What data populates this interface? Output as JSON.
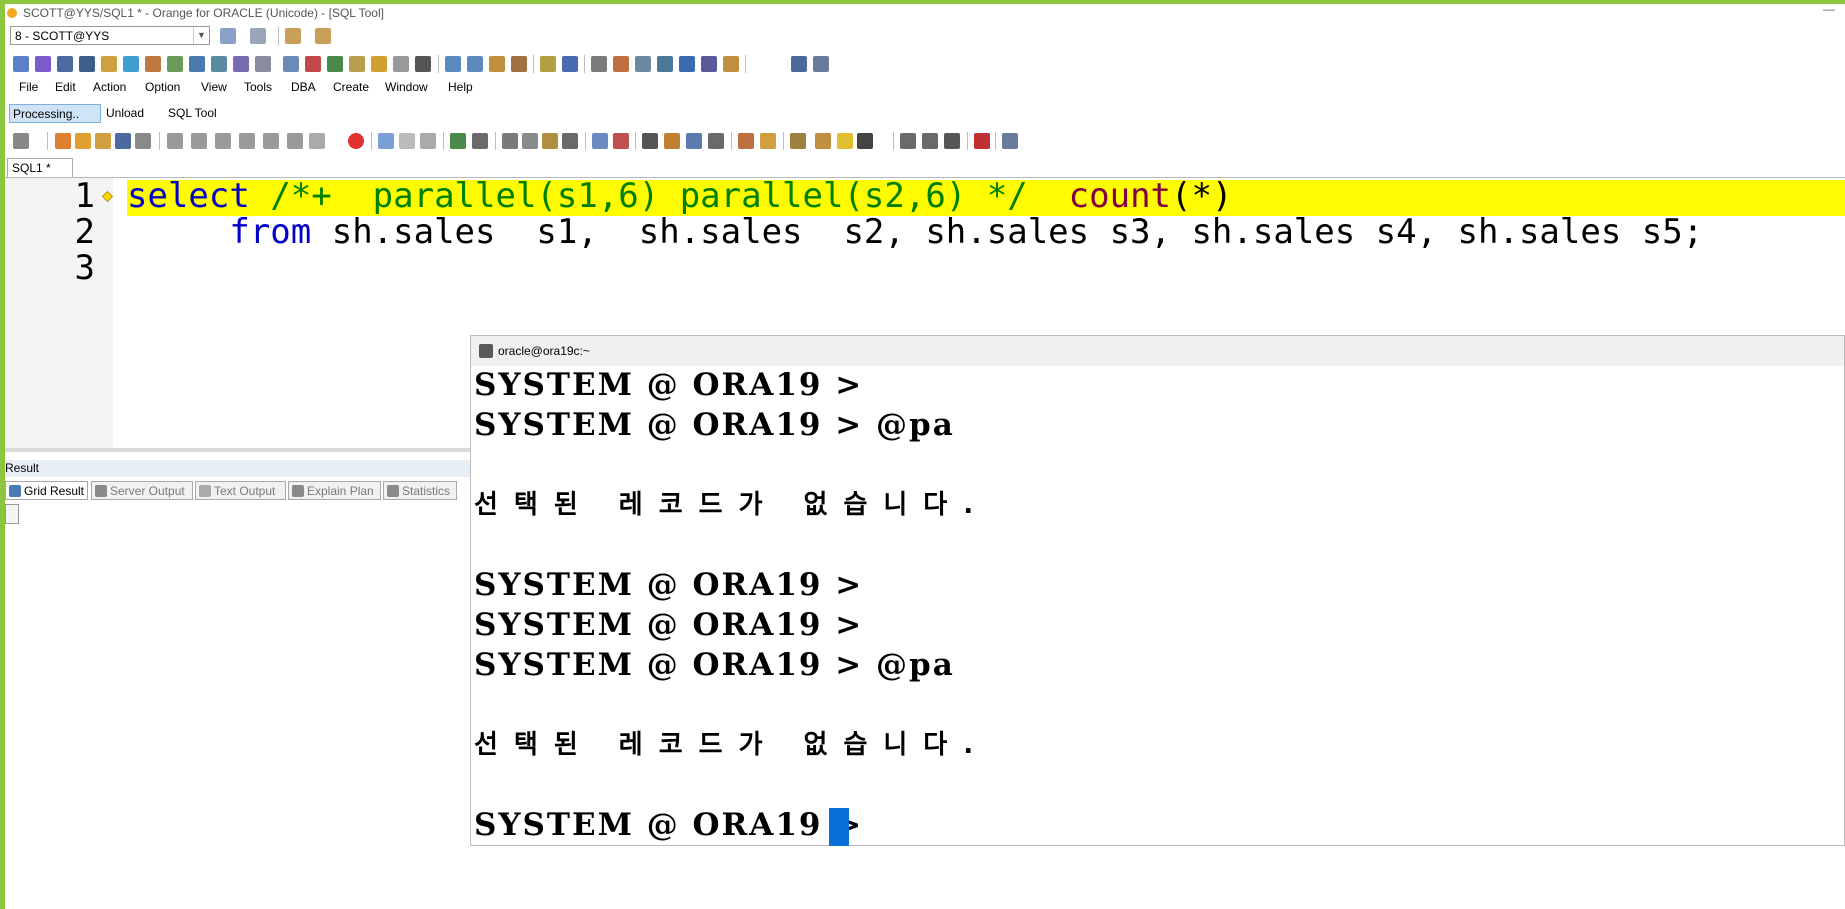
{
  "window": {
    "title": "SCOTT@YYS/SQL1 * - Orange for ORACLE (Unicode) - [SQL Tool]",
    "minimize": "—"
  },
  "connection": {
    "selected": "8 - SCOTT@YYS"
  },
  "menu": [
    "File",
    "Edit",
    "Action",
    "Option",
    "View",
    "Tools",
    "DBA",
    "Create",
    "Window",
    "Help"
  ],
  "tool_tabs": [
    "Processing..",
    "Unload",
    "SQL Tool"
  ],
  "editor": {
    "tab": "SQL1 *",
    "line_numbers": [
      "1",
      "2",
      "3"
    ],
    "line1": {
      "kw": "select",
      "comment": "/*+  parallel(s1,6) parallel(s2,6) */",
      "fn": "count",
      "args": "(*)"
    },
    "line2": {
      "kw": "from",
      "rest": " sh.sales  s1,  sh.sales  s2, sh.sales s3, sh.sales s4, sh.sales s5;"
    }
  },
  "result": {
    "header": "Result",
    "tabs": [
      "Grid Result",
      "Server Output",
      "Text Output",
      "Explain Plan",
      "Statistics"
    ]
  },
  "terminal": {
    "title": "oracle@ora19c:~",
    "lines": [
      "SYSTEM @ ORA19 >",
      "SYSTEM @ ORA19 > @pa",
      "",
      "선택된 레코드가 없습니다.",
      "",
      "SYSTEM @ ORA19 >",
      "SYSTEM @ ORA19 >",
      "SYSTEM @ ORA19 > @pa",
      "",
      "선택된 레코드가 없습니다.",
      "",
      "SYSTEM @ ORA19 >"
    ]
  },
  "colors": {
    "accent_green": "#8cc63f",
    "highlight": "#fffb00",
    "keyword": "#0000c8",
    "comment": "#008000",
    "function": "#800040",
    "cursor": "#0a6fd8"
  }
}
